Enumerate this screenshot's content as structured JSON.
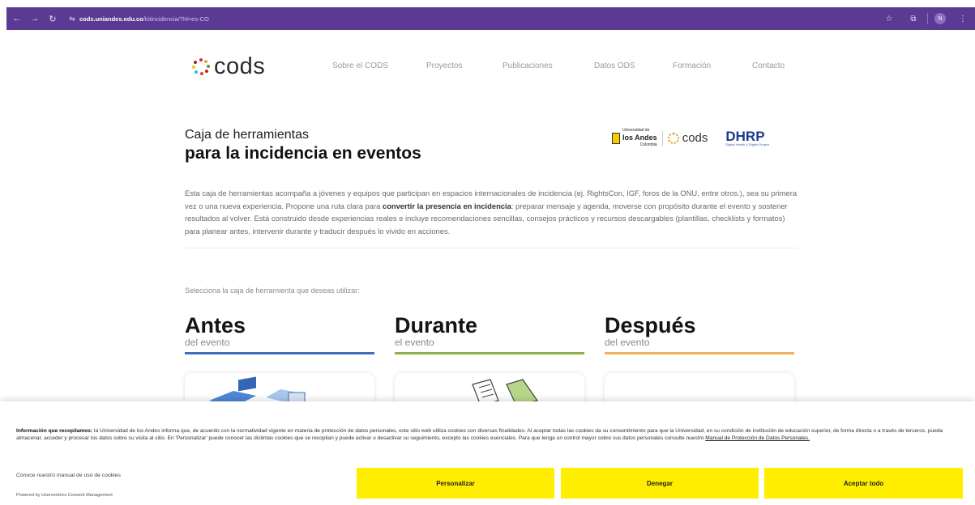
{
  "browser": {
    "url_domain": "cods.uniandes.edu.co",
    "url_path": "/kitincidencia/?hl=es-CO",
    "profile_initial": "N"
  },
  "site": {
    "logo_text": "cods",
    "nav": [
      "Sobre el CODS",
      "Proyectos",
      "Publicaciones",
      "Datos ODS",
      "Formación",
      "Contacto"
    ]
  },
  "intro": {
    "kicker": "Caja de herramientas",
    "title": "para la incidencia en eventos",
    "desc_1": "Esta caja de herramientas acompaña a jóvenes y equipos que participan en espacios internacionales de incidencia (ej. RightsCon, IGF, foros de la ONU, entre otros.), sea su primera vez o una nueva experiencia. Propone una ruta clara para ",
    "desc_bold": "convertir la presencia en incidencia",
    "desc_2": ": preparar mensaje y agenda, moverse con propósito durante el evento y sostener resultados al volver. Está construido desde experiencias reales e incluye recomendaciones sencillas, consejos prácticos y recursos descargables (plantillas, checklists y formatos) para planear antes, intervenir durante y traducir después lo vivido en acciones."
  },
  "partners": {
    "uandes_line1": "Universidad de",
    "uandes_line2": "los Andes",
    "uandes_line3": "Colombia",
    "cods": "cods",
    "dhrp": "DHRP",
    "dhrp_sub": "Digital Health & Rights Project"
  },
  "toolbox": {
    "select_label": "Selecciona la caja de herramienta que deseas utilizar:",
    "columns": [
      {
        "title": "Antes",
        "sub": "del evento",
        "color": "#3f6fc1"
      },
      {
        "title": "Durante",
        "sub": "el evento",
        "color": "#8db04a"
      },
      {
        "title": "Después",
        "sub": "del evento",
        "color": "#f0b060"
      }
    ]
  },
  "cookie": {
    "heading": "Información que recopilamos:",
    "body": " la Universidad de los Andes informa que, de acuerdo con la normatividad vigente en materia de protección de datos personales, este sitio web utiliza cookies con diversas finalidades. Al aceptar todas las cookies da su consentimiento para que la Universidad, en su condición de institución de educación superior, de forma directa o a través de terceros, pueda almacenar, acceder y procesar los datos sobre su visita al sitio. En 'Personalizar' puede conocer las distintas cookies que se recopilan y puede activar o desactivar su seguimiento, excepto las cookies esenciales. Para que tenga un control mayor sobre sus datos personales consulte nuestro ",
    "link": "Manual de Protección de Datos Personales.",
    "manual": "Conoce nuestro manual de uso de cookies",
    "powered": "Powered by Usercentrics Consent Management",
    "btn_personalizar": "Personalizar",
    "btn_denegar": "Denegar",
    "btn_aceptar": "Aceptar todo",
    "btn_color": "#ffee00"
  }
}
